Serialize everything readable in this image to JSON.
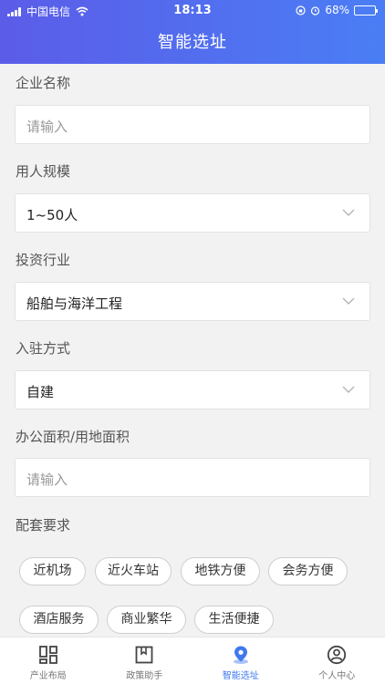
{
  "status_bar": {
    "carrier": "中国电信",
    "time": "18:13",
    "battery": "68%",
    "battery_level": 0.68
  },
  "header": {
    "title": "智能选址"
  },
  "form": {
    "company_name": {
      "label": "企业名称",
      "placeholder": "请输入"
    },
    "staff_size": {
      "label": "用人规模",
      "value": "1~50人"
    },
    "industry": {
      "label": "投资行业",
      "value": "船舶与海洋工程"
    },
    "settle_mode": {
      "label": "入驻方式",
      "value": "自建"
    },
    "area": {
      "label": "办公面积/用地面积",
      "placeholder": "请输入"
    },
    "facilities": {
      "label": "配套要求",
      "tags": [
        "近机场",
        "近火车站",
        "地铁方便",
        "会务方便",
        "酒店服务",
        "商业繁华",
        "生活便捷"
      ]
    }
  },
  "tabbar": {
    "items": [
      {
        "label": "产业布局",
        "icon": "grid-layout-icon",
        "active": false
      },
      {
        "label": "政策助手",
        "icon": "bookmark-book-icon",
        "active": false
      },
      {
        "label": "智能选址",
        "icon": "location-pin-icon",
        "active": true
      },
      {
        "label": "个人中心",
        "icon": "user-circle-icon",
        "active": false
      }
    ]
  },
  "colors": {
    "header_start": "#5b5ce8",
    "header_end": "#4a7ef5",
    "active_tab": "#3f78f0",
    "battery_fill": "#f3d23a"
  }
}
